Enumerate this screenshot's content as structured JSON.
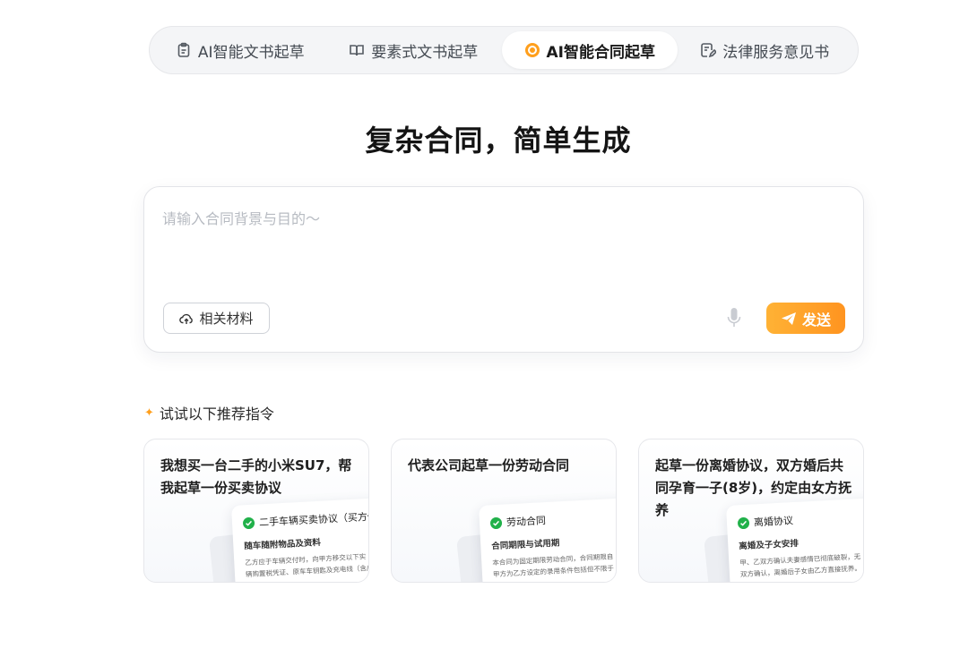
{
  "tabs": [
    {
      "label": "AI智能文书起草",
      "icon": "clipboard-icon",
      "active": false
    },
    {
      "label": "要素式文书起草",
      "icon": "book-icon",
      "active": false
    },
    {
      "label": "AI智能合同起草",
      "icon": "target-icon",
      "active": true
    },
    {
      "label": "法律服务意见书",
      "icon": "edit-doc-icon",
      "active": false
    }
  ],
  "hero": {
    "title": "复杂合同，简单生成"
  },
  "composer": {
    "placeholder": "请输入合同背景与目的～",
    "materials_label": "相关材料",
    "send_label": "发送"
  },
  "suggestions": {
    "header": "试试以下推荐指令",
    "cards": [
      {
        "text": "我想买一台二手的小米SU7，帮我起草一份买卖协议",
        "doc_title": "二手车辆买卖协议（买方保",
        "doc_sub": "随车随附物品及资料",
        "doc_body": "乙方应于车辆交付时，向甲方移交以下实\n辆购置税凭证、原车车钥匙及充电线（含/不含安装服务）"
      },
      {
        "text": "代表公司起草一份劳动合同",
        "doc_title": "劳动合同",
        "doc_sub": "合同期限与试用期",
        "doc_body": "本合同为固定期限劳动合同，合同期限自\n甲方为乙方设定的录用条件包括但不限于"
      },
      {
        "text": "起草一份离婚协议，双方婚后共同孕育一子(8岁)，约定由女方抚养",
        "doc_title": "离婚协议",
        "doc_sub": "离婚及子女安排",
        "doc_body": "甲、乙双方确认夫妻感情已彻底破裂，无\n双方确认，离婚后子女由乙方直接抚养。"
      }
    ]
  },
  "colors": {
    "accent": "#ff9f1c",
    "check": "#21b14a"
  }
}
